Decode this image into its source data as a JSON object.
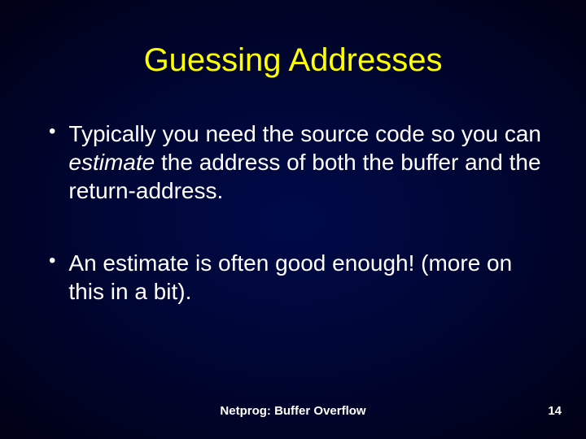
{
  "slide": {
    "title": "Guessing Addresses",
    "bullets": [
      {
        "before": "Typically you need the source code so you can ",
        "italic": "estimate",
        "after": " the address of both the buffer and the return-address."
      },
      {
        "before": "An estimate is often good enough! (more on this in a bit).",
        "italic": "",
        "after": ""
      }
    ],
    "footer_title": "Netprog: Buffer Overflow",
    "page_number": "14"
  }
}
